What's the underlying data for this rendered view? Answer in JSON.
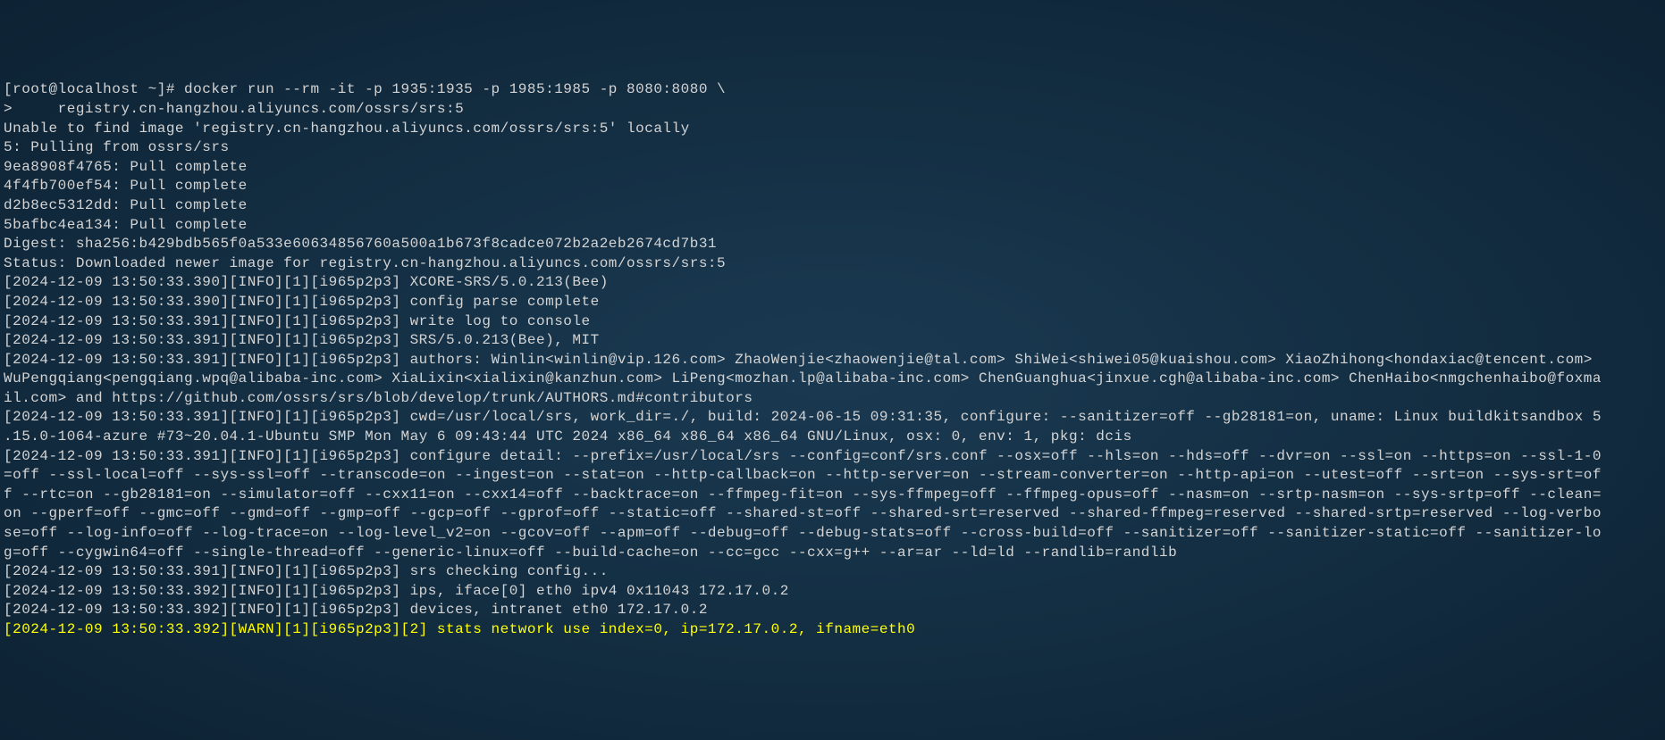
{
  "lines": [
    {
      "text": "[root@localhost ~]# docker run --rm -it -p 1935:1935 -p 1985:1985 -p 8080:8080 \\",
      "class": ""
    },
    {
      "text": ">     registry.cn-hangzhou.aliyuncs.com/ossrs/srs:5",
      "class": ""
    },
    {
      "text": "Unable to find image 'registry.cn-hangzhou.aliyuncs.com/ossrs/srs:5' locally",
      "class": ""
    },
    {
      "text": "5: Pulling from ossrs/srs",
      "class": ""
    },
    {
      "text": "9ea8908f4765: Pull complete",
      "class": ""
    },
    {
      "text": "4f4fb700ef54: Pull complete",
      "class": ""
    },
    {
      "text": "d2b8ec5312dd: Pull complete",
      "class": ""
    },
    {
      "text": "5bafbc4ea134: Pull complete",
      "class": ""
    },
    {
      "text": "Digest: sha256:b429bdb565f0a533e60634856760a500a1b673f8cadce072b2a2eb2674cd7b31",
      "class": ""
    },
    {
      "text": "Status: Downloaded newer image for registry.cn-hangzhou.aliyuncs.com/ossrs/srs:5",
      "class": ""
    },
    {
      "text": "[2024-12-09 13:50:33.390][INFO][1][i965p2p3] XCORE-SRS/5.0.213(Bee)",
      "class": ""
    },
    {
      "text": "[2024-12-09 13:50:33.390][INFO][1][i965p2p3] config parse complete",
      "class": ""
    },
    {
      "text": "[2024-12-09 13:50:33.391][INFO][1][i965p2p3] write log to console",
      "class": ""
    },
    {
      "text": "[2024-12-09 13:50:33.391][INFO][1][i965p2p3] SRS/5.0.213(Bee), MIT",
      "class": ""
    },
    {
      "text": "[2024-12-09 13:50:33.391][INFO][1][i965p2p3] authors: Winlin<winlin@vip.126.com> ZhaoWenjie<zhaowenjie@tal.com> ShiWei<shiwei05@kuaishou.com> XiaoZhihong<hondaxiac@tencent.com> WuPengqiang<pengqiang.wpq@alibaba-inc.com> XiaLixin<xialixin@kanzhun.com> LiPeng<mozhan.lp@alibaba-inc.com> ChenGuanghua<jinxue.cgh@alibaba-inc.com> ChenHaibo<nmgchenhaibo@foxmail.com> and https://github.com/ossrs/srs/blob/develop/trunk/AUTHORS.md#contributors",
      "class": ""
    },
    {
      "text": "[2024-12-09 13:50:33.391][INFO][1][i965p2p3] cwd=/usr/local/srs, work_dir=./, build: 2024-06-15 09:31:35, configure: --sanitizer=off --gb28181=on, uname: Linux buildkitsandbox 5.15.0-1064-azure #73~20.04.1-Ubuntu SMP Mon May 6 09:43:44 UTC 2024 x86_64 x86_64 x86_64 GNU/Linux, osx: 0, env: 1, pkg: dcis",
      "class": ""
    },
    {
      "text": "[2024-12-09 13:50:33.391][INFO][1][i965p2p3] configure detail: --prefix=/usr/local/srs --config=conf/srs.conf --osx=off --hls=on --hds=off --dvr=on --ssl=on --https=on --ssl-1-0=off --ssl-local=off --sys-ssl=off --transcode=on --ingest=on --stat=on --http-callback=on --http-server=on --stream-converter=on --http-api=on --utest=off --srt=on --sys-srt=off --rtc=on --gb28181=on --simulator=off --cxx11=on --cxx14=off --backtrace=on --ffmpeg-fit=on --sys-ffmpeg=off --ffmpeg-opus=off --nasm=on --srtp-nasm=on --sys-srtp=off --clean=on --gperf=off --gmc=off --gmd=off --gmp=off --gcp=off --gprof=off --static=off --shared-st=off --shared-srt=reserved --shared-ffmpeg=reserved --shared-srtp=reserved --log-verbose=off --log-info=off --log-trace=on --log-level_v2=on --gcov=off --apm=off --debug=off --debug-stats=off --cross-build=off --sanitizer=off --sanitizer-static=off --sanitizer-log=off --cygwin64=off --single-thread=off --generic-linux=off --build-cache=on --cc=gcc --cxx=g++ --ar=ar --ld=ld --randlib=randlib",
      "class": ""
    },
    {
      "text": "[2024-12-09 13:50:33.391][INFO][1][i965p2p3] srs checking config...",
      "class": ""
    },
    {
      "text": "[2024-12-09 13:50:33.392][INFO][1][i965p2p3] ips, iface[0] eth0 ipv4 0x11043 172.17.0.2",
      "class": ""
    },
    {
      "text": "[2024-12-09 13:50:33.392][INFO][1][i965p2p3] devices, intranet eth0 172.17.0.2",
      "class": ""
    },
    {
      "text": "[2024-12-09 13:50:33.392][WARN][1][i965p2p3][2] stats network use index=0, ip=172.17.0.2, ifname=eth0",
      "class": "warn"
    }
  ],
  "wrap_width": 177
}
